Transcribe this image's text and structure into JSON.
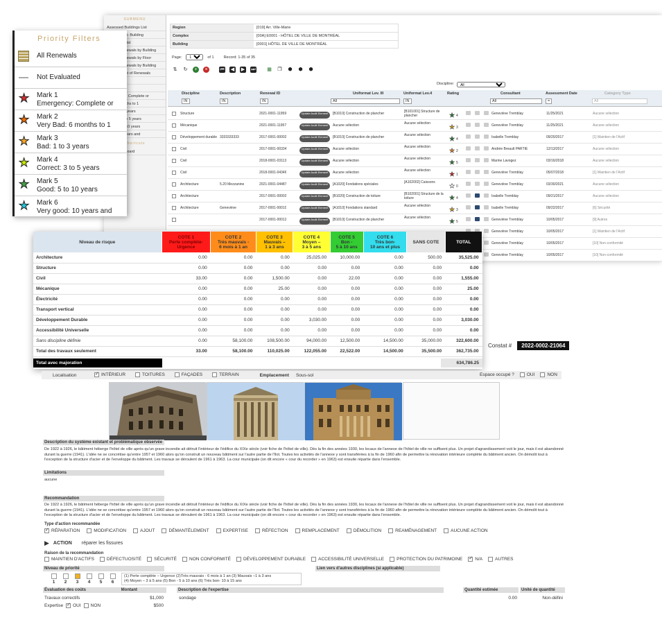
{
  "sidebar": {
    "section_title": "SUBMENU",
    "items": [
      "Assessed Buildings List",
      "Assessment- Building",
      "Renewals List",
      "Interior Renewals by Building",
      "Interior Renewals by Floor",
      "Annual Renewals by Building",
      "Update - List of Renewals",
      "Renewals",
      "Evaluated",
      "Emergency: Complete or",
      "Bad: 6 months to 1",
      "Bad: 1 to 3 years",
      "Correct: 3 to 5 years",
      "Good: 5 to 10 years",
      "Good: 10 years and"
    ],
    "priority_title": "Priority Filters",
    "shortcuts_title": "Shortcuts",
    "goto_dashboard": "Goto Dashboard"
  },
  "meta": {
    "rows": [
      {
        "k": "Region",
        "v": "[019] Arr. Ville-Marie"
      },
      {
        "k": "Complex",
        "v": "[00A] E0001 - HÔTEL DE VILLE DE MONTRÉAL"
      },
      {
        "k": "Building",
        "v": "[0001] HÔTEL DE VILLE DE MONTRÉAL"
      }
    ]
  },
  "pager": {
    "page_label": "Page:",
    "page_value": "1",
    "of_label": "of 1",
    "record_label": "Record: 1-35 of 35"
  },
  "discipline_filter": {
    "label": "Discipline:",
    "value": "All"
  },
  "grid": {
    "headers": [
      "Discipline",
      "Description",
      "Renewal ID",
      "Uniformat Lev. III",
      "Uniformat Lev.4",
      "Rating",
      "Consultant",
      "Assessment Date",
      "Category Type"
    ],
    "filter_values": {
      "discipline": "IN",
      "description": "IN",
      "renewal": "IN",
      "lev3": "All",
      "lev4": "IN",
      "consultant": "All",
      "date": "=",
      "category": "All"
    },
    "update_label": "Update Audit Element",
    "rows": [
      {
        "disc": "Structure",
        "desc": "",
        "id": "2021-0001-11959",
        "lev3": "[B1010] Construction de plancher",
        "lev4": "[B101001] Structure de plancher",
        "stars": "4",
        "cons": "Geneviève Tremblay",
        "date": "11/25/2021",
        "cat": "Aucune sélection",
        "star": "#2e7d32"
      },
      {
        "disc": "Mécanique",
        "desc": "",
        "id": "2021-0001-11957",
        "lev3": "Aucune sélection",
        "lev4": "Aucune sélection",
        "stars": "3",
        "cons": "Geneviève Tremblay",
        "date": "11/25/2021",
        "cat": "Aucune sélection",
        "star": "#d4a017"
      },
      {
        "disc": "Développement durable",
        "desc": "3333333333",
        "id": "2017-0001-00002",
        "lev3": "[B1010] Construction de plancher",
        "lev4": "Aucune sélection",
        "stars": "4",
        "cons": "Isabelle Tremblay",
        "date": "09/20/2017",
        "cat": "[1] Maintien de l'Actif",
        "star": "#2e7d32"
      },
      {
        "disc": "Civil",
        "desc": "",
        "id": "2017-0001-00334",
        "lev3": "Aucune sélection",
        "lev4": "Aucune sélection",
        "stars": "2",
        "cons": "Andrée Breault PARTIE",
        "date": "12/13/2017",
        "cat": "Aucune sélection",
        "star": "#e67e22"
      },
      {
        "disc": "Civil",
        "desc": "",
        "id": "2018-0001-03113",
        "lev3": "Aucune sélection",
        "lev4": "Aucune sélection",
        "stars": "5",
        "cons": "Marine Lavogez",
        "date": "03/16/2018",
        "cat": "Aucune sélection",
        "star": "#2e7d32"
      },
      {
        "disc": "Civil",
        "desc": "",
        "id": "2018-0001-04346",
        "lev3": "Aucune sélection",
        "lev4": "Aucune sélection",
        "stars": "1",
        "cons": "Geneviève Tremblay",
        "date": "05/07/2018",
        "cat": "[1] Maintien de l'Actif",
        "star": "#c62828"
      },
      {
        "disc": "Architecture",
        "desc": "5.20 Mezzanine",
        "id": "2021-0001-04487",
        "lev3": "[A1020] Fondations spéciales",
        "lev4": "[A102002] Caissons",
        "stars": "0",
        "cons": "Geneviève Tremblay",
        "date": "03/30/2021",
        "cat": "Aucune sélection",
        "star": "#fff"
      },
      {
        "disc": "Architecture",
        "desc": "",
        "id": "2017-0001-00003",
        "lev3": "[B1020] Construction de toiture",
        "lev4": "[B102001] Structure de la toiture",
        "stars": "4",
        "cons": "Isabelle Tremblay",
        "date": "09/21/2017",
        "cat": "Aucune sélection",
        "star": "#2e7d32"
      },
      {
        "disc": "Architecture",
        "desc": "Geneviève",
        "id": "2017-0001-00010",
        "lev3": "[A1010] Fondations standard",
        "lev4": "Aucune sélection",
        "stars": "3",
        "cons": "Isabelle Tremblay",
        "date": "09/22/2017",
        "cat": "[6] Sécurité",
        "star": "#d4a017"
      },
      {
        "disc": "",
        "desc": "",
        "id": "2017-0001-00012",
        "lev3": "[B1010] Construction de plancher",
        "lev4": "Aucune sélection",
        "stars": "5",
        "cons": "Geneviève Tremblay",
        "date": "10/05/2017",
        "cat": "[9] Autres",
        "star": "#2e7d32"
      },
      {
        "disc": "",
        "desc": "",
        "id": "",
        "lev3": "",
        "lev4": "",
        "stars": "",
        "cons": "Geneviève Tremblay",
        "date": "10/05/2017",
        "cat": "[1] Maintien de l'Actif",
        "star": ""
      },
      {
        "disc": "",
        "desc": "",
        "id": "",
        "lev3": "",
        "lev4": "",
        "stars": "",
        "cons": "Geneviève Tremblay",
        "date": "10/05/2017",
        "cat": "[10] Non-conformité",
        "star": ""
      },
      {
        "disc": "",
        "desc": "",
        "id": "",
        "lev3": "",
        "lev4": "",
        "stars": "",
        "cons": "Geneviève Tremblay",
        "date": "10/05/2017",
        "cat": "[10] Non-conformité",
        "star": ""
      }
    ]
  },
  "priority": {
    "title": "Priority Filters",
    "items": [
      {
        "l1": "All Renewals",
        "l2": "",
        "color": "grid"
      },
      {
        "l1": "Not Evaluated",
        "l2": "",
        "color": "dash"
      },
      {
        "l1": "Mark 1",
        "l2": "Emergency: Complete or",
        "color": "#d32f2f"
      },
      {
        "l1": "Mark 2",
        "l2": "Very Bad: 6 months to 1",
        "color": "#ef6c00"
      },
      {
        "l1": "Mark 3",
        "l2": "Bad: 1 to 3 years",
        "color": "#f9a825"
      },
      {
        "l1": "Mark 4",
        "l2": "Correct: 3 to 5 years",
        "color": "#c6e600"
      },
      {
        "l1": "Mark 5",
        "l2": "Good: 5 to 10 years",
        "color": "#43a047"
      },
      {
        "l1": "Mark 6",
        "l2": "Very good: 10 years and",
        "color": "#26c6da"
      }
    ]
  },
  "costs": {
    "headers": [
      {
        "t": "Niveau de risque",
        "bg": "#dbe5ef"
      },
      {
        "t": "COTE 1\nPerte complète-\nUrgence",
        "bg": "#ff1a1a"
      },
      {
        "t": "COTE 2\nTrès mauvais -\n6 mois à 1 an",
        "bg": "#ff8c1a"
      },
      {
        "t": "COTE 3\nMauvais –\n1 à 3 ans",
        "bg": "#ffc000"
      },
      {
        "t": "COTE 4\nMoyen –\n3 à 5 ans",
        "bg": "#ffff33"
      },
      {
        "t": "COTE 5\nBon -\n5 à 10 ans",
        "bg": "#33cc33"
      },
      {
        "t": "COTE 6\nTrès bon-\n10 ans et plus",
        "bg": "#33ddee"
      },
      {
        "t": "SANS COTE",
        "bg": "#e6e6e6"
      },
      {
        "t": "TOTAL",
        "bg": "#111"
      }
    ],
    "rows": [
      {
        "n": "Architecture",
        "v": [
          "0.00",
          "0.00",
          "0.00",
          "25,025.00",
          "10,000.00",
          "0.00",
          "500.00",
          "35,525.00"
        ]
      },
      {
        "n": "Structure",
        "v": [
          "0.00",
          "0.00",
          "0.00",
          "0.00",
          "0.00",
          "0.00",
          "0.00",
          "0.00"
        ]
      },
      {
        "n": "Civil",
        "v": [
          "33.00",
          "0.00",
          "1,500.00",
          "0.00",
          "22.00",
          "0.00",
          "0.00",
          "1,555.00"
        ]
      },
      {
        "n": "Mécanique",
        "v": [
          "0.00",
          "0.00",
          "25.00",
          "0.00",
          "0.00",
          "0.00",
          "0.00",
          "25.00"
        ]
      },
      {
        "n": "Électricité",
        "v": [
          "0.00",
          "0.00",
          "0.00",
          "0.00",
          "0.00",
          "0.00",
          "0.00",
          "0.00"
        ]
      },
      {
        "n": "Transport vertical",
        "v": [
          "0.00",
          "0.00",
          "0.00",
          "0.00",
          "0.00",
          "0.00",
          "0.00",
          "0.00"
        ]
      },
      {
        "n": "Développement Durable",
        "v": [
          "0.00",
          "0.00",
          "0.00",
          "3,030.00",
          "0.00",
          "0.00",
          "0.00",
          "3,030.00"
        ]
      },
      {
        "n": "Accessibilité Universelle",
        "v": [
          "0.00",
          "0.00",
          "0.00",
          "0.00",
          "0.00",
          "0.00",
          "0.00",
          "0.00"
        ]
      },
      {
        "n": "Sans discipline définie",
        "v": [
          "0.00",
          "58,100.00",
          "108,500.00",
          "94,000.00",
          "12,500.00",
          "14,500.00",
          "35,000.00",
          "322,600.00"
        ]
      },
      {
        "n": "Total des travaux seulement",
        "v": [
          "33.00",
          "58,100.00",
          "110,025.00",
          "122,055.00",
          "22,522.00",
          "14,500.00",
          "35,500.00",
          "362,735.00"
        ]
      }
    ],
    "grand_label": "Total avec majoration",
    "grand_value": "634,786.25"
  },
  "constat": {
    "label": "Constat #",
    "value": "2022-0002-21064"
  },
  "localisation": {
    "label": "Localisation",
    "options": [
      {
        "t": "INTÉRIEUR",
        "on": true
      },
      {
        "t": "TOITURES",
        "on": false
      },
      {
        "t": "FAÇADES",
        "on": false
      },
      {
        "t": "TERRAIN",
        "on": false
      }
    ],
    "emplacement_label": "Emplacement",
    "emplacement_value": "Sous-sol",
    "espace_label": "Espace occupé ?",
    "oui": "OUI",
    "non": "NON"
  },
  "description": {
    "title": "Description du système existant et problématique observée",
    "text": "De 1922 à 1926, le bâtiment héberge l'hôtel de ville après qu'un grave incendie ait détruit l'intérieur de l'édifice du XIXe siècle (voir fiche de l'hôtel de ville). Dès la fin des années 1930, les locaux de l'annexe de l'hôtel de ville ne suffisent plus. Un projet d'agrandissement voit le jour, mais il est abandonné durant la guerre (1941). L'idée ne se concrétise qu'entre 1957 et 1960 alors qu'on construit un nouveau bâtiment sur l'autre partie de l'îlot. Toutes les activités de l'annexe y sont transférées à la fin de 1960 afin de permettre la rénovation intérieure complète du bâtiment ancien. On démolit tout à l'exception de la structure d'acier et de l'enveloppe du bâtiment. Les travaux se déroulent de 1961 à 1963. La cour municipale (on dit encore « cour du recorder » en 1963) est ensuite répartie dans l'ensemble."
  },
  "limitations": {
    "title": "Limitations",
    "text": "aucune"
  },
  "recommandation": {
    "title": "Recommandation",
    "text": "De 1922 à 1926, le bâtiment héberge l'hôtel de ville après qu'un grave incendie ait détruit l'intérieur de l'édifice du XIXe siècle (voir fiche de l'hôtel de ville). Dès la fin des années 1930, les locaux de l'annexe de l'hôtel de ville ne suffisent plus. Un projet d'agrandissement voit le jour, mais il est abandonné durant la guerre (1941). L'idée ne se concrétise qu'entre 1957 et 1960 alors qu'on construit un nouveau bâtiment sur l'autre partie de l'îlot. Toutes les activités de l'annexe y sont transférées à la fin de 1960 afin de permettre la rénovation intérieure complète du bâtiment ancien. On démolit tout à l'exception de la structure d'acier et de l'enveloppe du bâtiment. Les travaux se déroulent de 1961 à 1963. La cour municipale (on dit encore « cour du recorder » en 1963) est ensuite répartie dans l'ensemble."
  },
  "action_type": {
    "title": "Type d'action recommandée",
    "options": [
      {
        "t": "RÉPARATION",
        "on": true
      },
      {
        "t": "MODIFICATION",
        "on": false
      },
      {
        "t": "AJOUT",
        "on": false
      },
      {
        "t": "DÉMANTÈLEMENT",
        "on": false
      },
      {
        "t": "EXPERTISE",
        "on": false
      },
      {
        "t": "RÉFECTION",
        "on": false
      },
      {
        "t": "REMPLACEMENT",
        "on": false
      },
      {
        "t": "DÉMOLITION",
        "on": false
      },
      {
        "t": "REAMÉNAGEMENT",
        "on": false
      },
      {
        "t": "AUCUNE ACTION",
        "on": false
      }
    ],
    "action_label": "ACTION",
    "action_value": "réparer les fissures"
  },
  "raison": {
    "title": "Raison de la recommandation",
    "options": [
      {
        "t": "MAINTIEN D'ACTIFS",
        "on": false
      },
      {
        "t": "DÉFECTUOSITÉ",
        "on": false
      },
      {
        "t": "SÉCURITÉ",
        "on": false
      },
      {
        "t": "NON CONFORMITÉ",
        "on": false
      },
      {
        "t": "DÉVELOPPEMENT DURABLE",
        "on": false
      },
      {
        "t": "ACCESSIBILITÉ UNIVERSELLE",
        "on": false
      },
      {
        "t": "PROTECTION DU PATRIMOINE",
        "on": false
      },
      {
        "t": "N/A",
        "on": true
      },
      {
        "t": "AUTRES",
        "on": false
      }
    ]
  },
  "priority_level": {
    "title": "Niveau de priorité",
    "numbers": [
      "1",
      "2",
      "3",
      "4",
      "5",
      "6"
    ],
    "selected": "3",
    "legend_l1": "(1) Perte complète – Urgence     (2)Très mauvais - 6 mois à 1 an     (3) Mauvais –1 à 3 ans",
    "legend_l2": "(4) Moyen – 3 à 5 ans     (5) Bon - 5 à 10 ans     (6) Très bon- 10 à 15 ans",
    "links_title": "Lien vers d'autres disciplines (si applicable)"
  },
  "evaluation": {
    "title": "Évaluation des coûts",
    "montant": "Montant",
    "desc_title": "Description de l'expertise",
    "desc_value": "sondage",
    "qty_title": "Quantité estimée",
    "qty_value": "0.00",
    "unit_title": "Unité de quantité",
    "unit_value": "Non-défini",
    "travaux_label": "Travaux correctifs",
    "travaux_value": "$1,000",
    "expertise_label": "Expertise",
    "oui": "OUI",
    "non": "NON",
    "expertise_value": "$500"
  }
}
